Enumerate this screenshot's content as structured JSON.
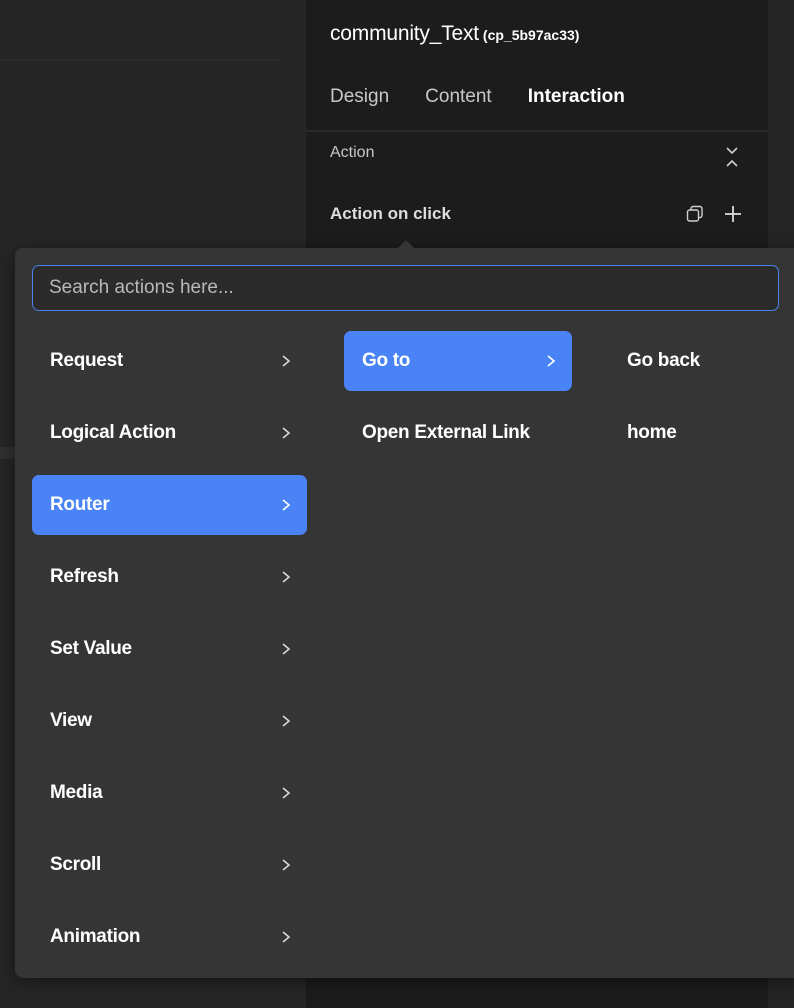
{
  "panel": {
    "title": "community_Text",
    "component_id": "(cp_5b97ac33)",
    "tabs": [
      {
        "label": "Design"
      },
      {
        "label": "Content"
      },
      {
        "label": "Interaction"
      }
    ],
    "active_tab": "Interaction",
    "section_header": "Action",
    "action_on_click": "Action on click"
  },
  "popup": {
    "search_placeholder": "Search actions here...",
    "search_value": "",
    "categories": [
      {
        "label": "Request"
      },
      {
        "label": "Logical Action"
      },
      {
        "label": "Router"
      },
      {
        "label": "Refresh"
      },
      {
        "label": "Set Value"
      },
      {
        "label": "View"
      },
      {
        "label": "Media"
      },
      {
        "label": "Scroll"
      },
      {
        "label": "Animation"
      }
    ],
    "selected_category": "Router",
    "router_actions": [
      {
        "label": "Go to"
      },
      {
        "label": "Open External Link"
      }
    ],
    "selected_router_action": "Go to",
    "goto_targets": [
      {
        "label": "Go back"
      },
      {
        "label": "home"
      }
    ]
  },
  "icons": {
    "chevron": "chevron-right-icon",
    "collapse": "collapse-icon",
    "copy": "copy-icon",
    "add": "plus-icon"
  },
  "colors": {
    "accent": "#4a83f5",
    "popup_bg": "#353535",
    "panel_bg": "#1c1c1c",
    "search_border": "#4a83ec"
  }
}
